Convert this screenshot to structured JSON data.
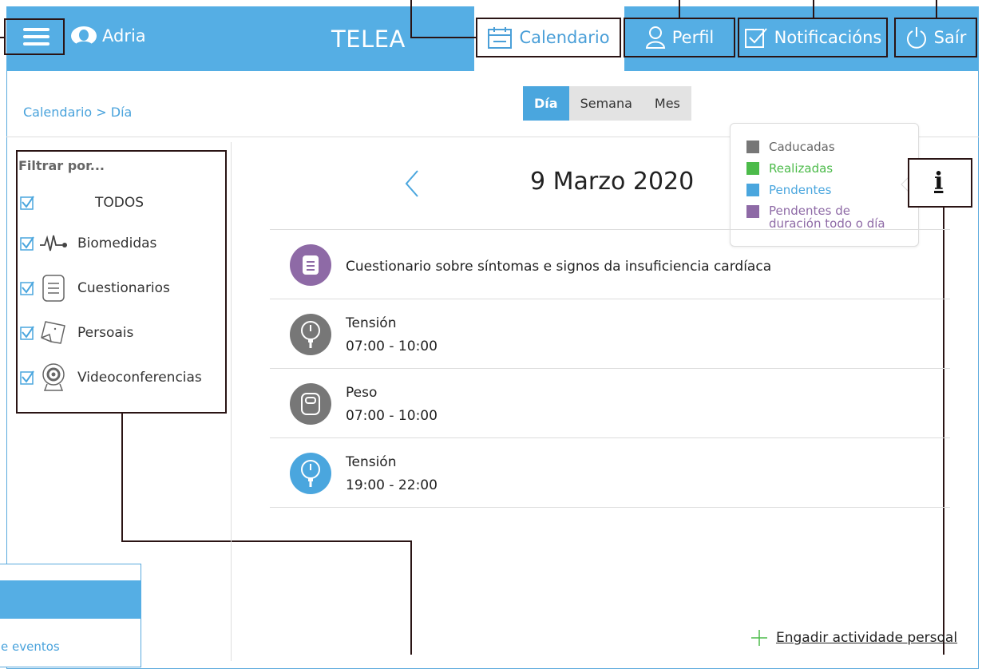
{
  "header": {
    "user_name": "Adria",
    "brand": "TELEA",
    "nav": [
      {
        "label": "Calendario",
        "icon": "calendar-icon",
        "active": true
      },
      {
        "label": "Perfil",
        "icon": "user-icon"
      },
      {
        "label": "Notificacións",
        "icon": "checkbox-icon"
      },
      {
        "label": "Saír",
        "icon": "power-icon"
      }
    ]
  },
  "breadcrumb": "Calendario > Día",
  "view_tabs": [
    "Día",
    "Semana",
    "Mes"
  ],
  "filter": {
    "title": "Filtrar por...",
    "items": [
      {
        "label": "TODOS",
        "icon": ""
      },
      {
        "label": "Biomedidas",
        "icon": "heartbeat-icon"
      },
      {
        "label": "Cuestionarios",
        "icon": "document-icon"
      },
      {
        "label": "Persoais",
        "icon": "sticky-note-icon"
      },
      {
        "label": "Videoconferencias",
        "icon": "webcam-icon"
      }
    ]
  },
  "date": "9 Marzo 2020",
  "legend": [
    {
      "label": "Caducadas",
      "color": "#777777"
    },
    {
      "label": "Realizadas",
      "color": "#4cbb4a"
    },
    {
      "label": "Pendentes",
      "color": "#4aa6de"
    },
    {
      "label": "Pendentes de duración todo o día",
      "color": "#8e6aa6"
    }
  ],
  "info_label": "i",
  "events": [
    {
      "title": "Cuestionario sobre síntomas e signos da insuficiencia cardíaca",
      "time": "",
      "color": "#8e6aa6",
      "icon": "document-icon"
    },
    {
      "title": "Tensión",
      "time": "07:00 - 10:00",
      "color": "#777777",
      "icon": "blood-pressure-icon"
    },
    {
      "title": "Peso",
      "time": "07:00 - 10:00",
      "color": "#777777",
      "icon": "scale-icon"
    },
    {
      "title": "Tensión",
      "time": "19:00 - 22:00",
      "color": "#4aa6de",
      "icon": "blood-pressure-icon"
    }
  ],
  "add_activity": "Engadir actividade persoal",
  "overlay_text": "e eventos",
  "colors": {
    "primary": "#55aee4",
    "annotation": "#2a1414",
    "accent_green": "#4cbb4a"
  }
}
